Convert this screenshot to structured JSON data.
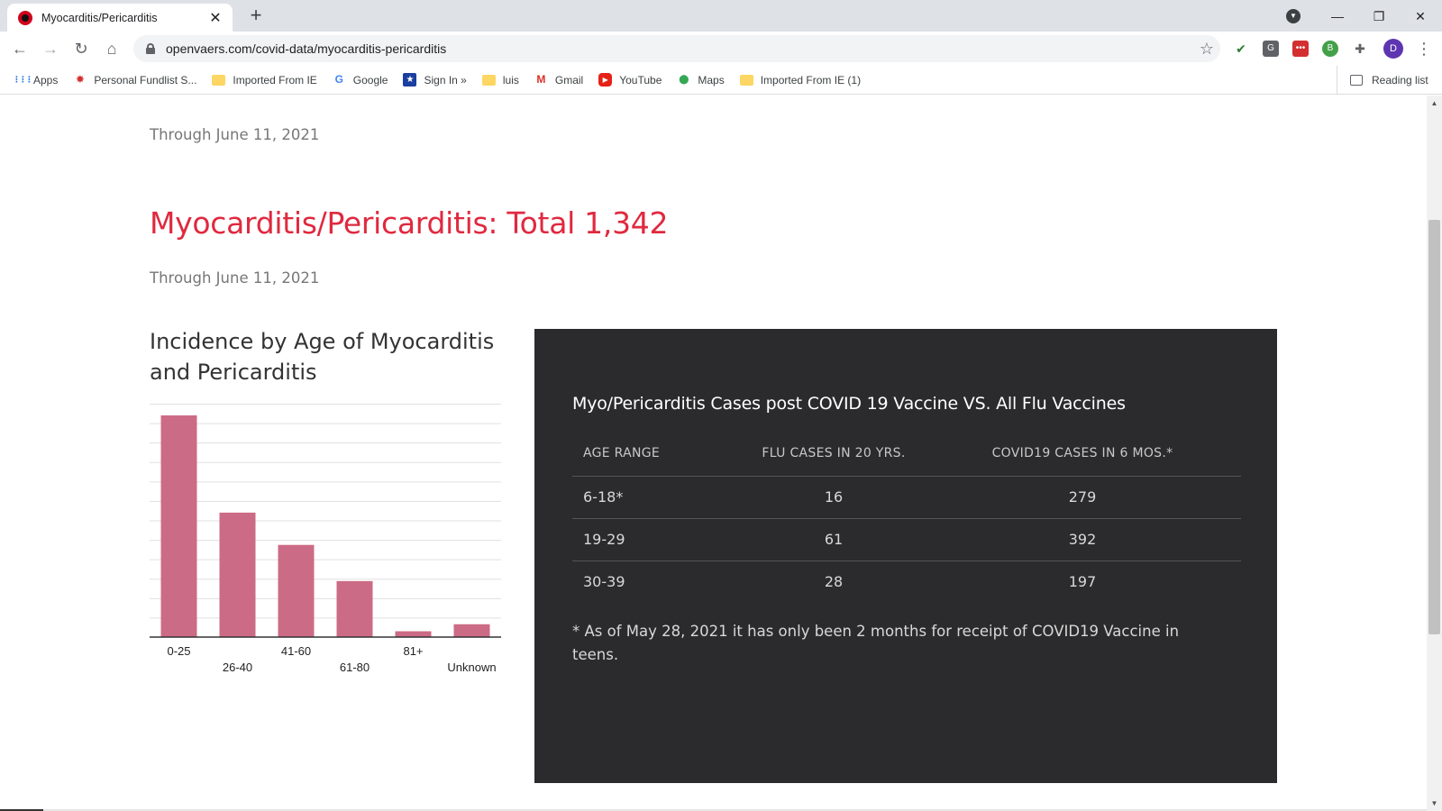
{
  "browser": {
    "tab": {
      "title": "Myocarditis/Pericarditis"
    },
    "url": "openvaers.com/covid-data/myocarditis-pericarditis",
    "profile_initial": "D",
    "bookmarks": [
      {
        "label": "Apps",
        "icon": "apps-grid-icon"
      },
      {
        "label": "Personal Fundlist S...",
        "icon": "maple-leaf-icon"
      },
      {
        "label": "Imported From IE",
        "icon": "folder-icon"
      },
      {
        "label": "Google",
        "icon": "google-icon"
      },
      {
        "label": "Sign In »",
        "icon": "star-badge-icon"
      },
      {
        "label": "luis",
        "icon": "folder-icon"
      },
      {
        "label": "Gmail",
        "icon": "gmail-icon"
      },
      {
        "label": "YouTube",
        "icon": "youtube-icon"
      },
      {
        "label": "Maps",
        "icon": "maps-pin-icon"
      },
      {
        "label": "Imported From IE (1)",
        "icon": "folder-icon"
      }
    ],
    "reading_list": "Reading list"
  },
  "page": {
    "through_top": "Through June 11, 2021",
    "title": "Myocarditis/Pericarditis: Total 1,342",
    "through": "Through June 11, 2021",
    "chart_title": "Incidence by Age of Myocarditis and Pericarditis"
  },
  "chart_data": {
    "type": "bar",
    "title": "Incidence by Age of Myocarditis and Pericarditis",
    "categories": [
      "0-25",
      "26-40",
      "41-60",
      "61-80",
      "81+",
      "Unknown"
    ],
    "values": [
      570,
      320,
      237,
      144,
      15,
      33
    ],
    "ylim": [
      0,
      600
    ],
    "grid": true,
    "color": "#cc6b85",
    "legend": "none"
  },
  "panel": {
    "title": "Myo/Pericarditis Cases post COVID 19 Vaccine VS. All Flu Vaccines",
    "headers": [
      "AGE RANGE",
      "FLU CASES IN 20 YRS.",
      "COVID19 CASES IN 6 MOS.*"
    ],
    "rows": [
      [
        "6-18*",
        "16",
        "279"
      ],
      [
        "19-29",
        "61",
        "392"
      ],
      [
        "30-39",
        "28",
        "197"
      ]
    ],
    "footnote": "* As of May 28, 2021 it has only been 2 months for receipt of COVID19 Vaccine in teens."
  },
  "colors": {
    "title_red": "#e0293f",
    "bar_pink": "#cc6b85",
    "panel_bg": "#2b2b2d"
  }
}
